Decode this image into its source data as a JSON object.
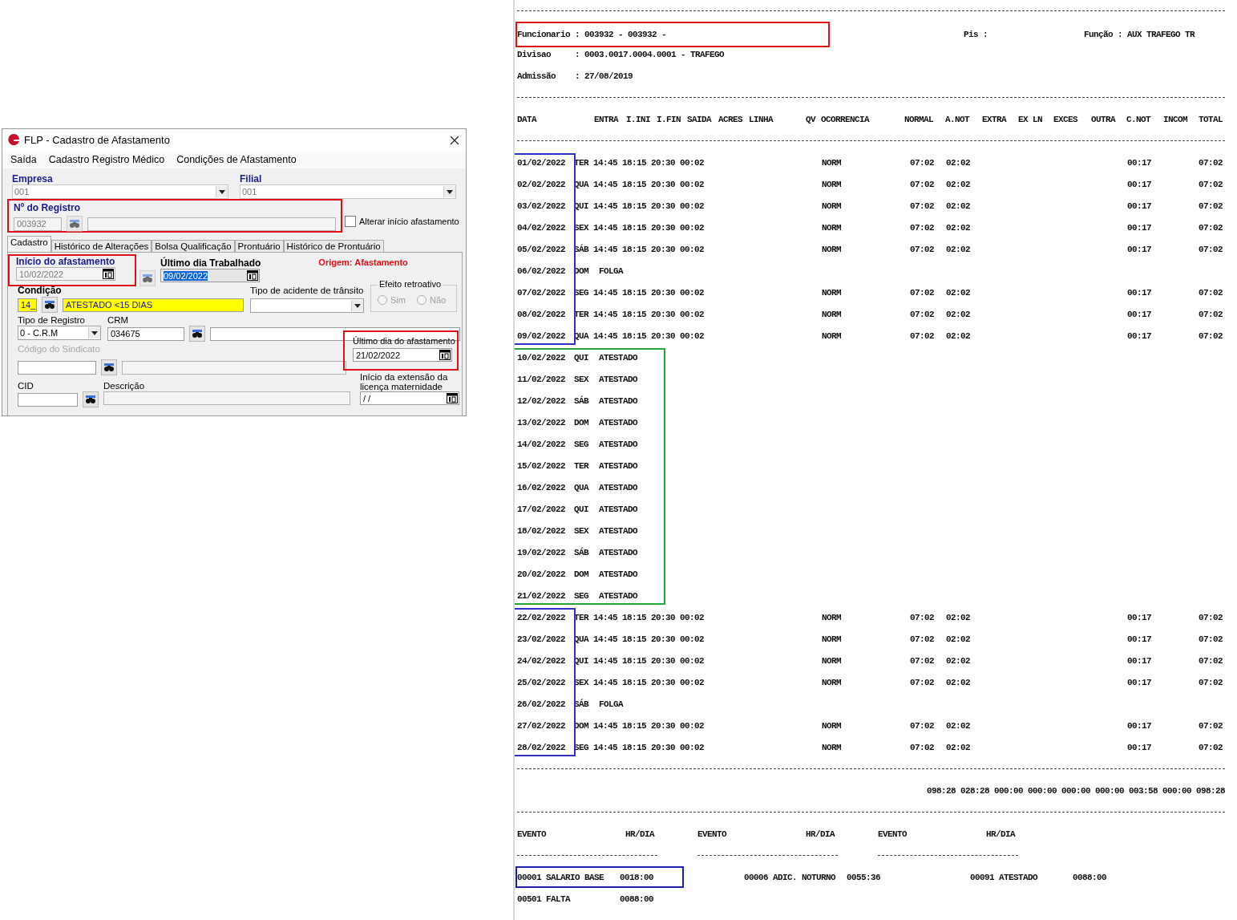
{
  "dialog": {
    "title": "FLP - Cadastro de Afastamento",
    "menu": [
      "Saída",
      "Cadastro Registro Médico",
      "Condições de Afastamento"
    ],
    "empresa": {
      "label": "Empresa",
      "value": "001"
    },
    "filial": {
      "label": "Filial",
      "value": "001"
    },
    "registro": {
      "label": "Nº do Registro",
      "value": "003932",
      "highlighted": true
    },
    "alterar_inicio": {
      "label": "Alterar início afastamento",
      "checked": false
    },
    "tabs": [
      {
        "label": "Cadastro",
        "selected": true
      },
      {
        "label": "Histórico de Alterações",
        "selected": false
      },
      {
        "label": "Bolsa Qualificação",
        "selected": false
      },
      {
        "label": "Prontuário",
        "selected": false
      },
      {
        "label": "Histórico de Prontuário",
        "selected": false
      }
    ],
    "inicio": {
      "label": "Início do afastamento",
      "value": "10/02/2022",
      "highlighted": true
    },
    "ultimo_trabalhado": {
      "label": "Último dia Trabalhado",
      "value": "09/02/2022"
    },
    "origem": "Origem: Afastamento",
    "condicao": {
      "label": "Condição",
      "code": "14_",
      "description": "ATESTADO <15 DIAS"
    },
    "tipo_acidente": {
      "label": "Tipo de acidente de trânsito"
    },
    "efeito_retroativo": {
      "label": "Efeito retroativo",
      "options": [
        {
          "label": "Sim",
          "selected": false
        },
        {
          "label": "Não",
          "selected": false
        }
      ]
    },
    "tipo_registro": {
      "label": "Tipo de Registro",
      "value": "0 - C.R.M"
    },
    "crm": {
      "label": "CRM",
      "value": "034675"
    },
    "codigo_sindicato": {
      "label": "Código do Sindicato",
      "disabled": true
    },
    "ultimo_afastamento": {
      "label": "Último dia do afastamento",
      "value": "21/02/2022",
      "highlighted": true
    },
    "extensao": {
      "label": "Início da extensão da licença maternidade",
      "value": "/ /"
    },
    "cid": {
      "label": "CID"
    },
    "descricao": {
      "label": "Descrição"
    }
  },
  "report": {
    "funcionario": {
      "text": "Funcionario : 003932 - 003932 -",
      "highlighted": true
    },
    "pis": "Pis :",
    "funcao": "Função : AUX TRAFEGO TR",
    "divisao": "Divisao     : 0003.0017.0004.0001 - TRAFEGO",
    "admissao": "Admissão    : 27/08/2019",
    "columns": [
      "DATA",
      "ENTRA",
      "I.INI",
      "I.FIN",
      "SAIDA",
      "ACRES",
      "LINHA",
      "QV",
      "OCORRENCIA",
      "NORMAL",
      "A.NOT",
      "EXTRA",
      "EX LN",
      "EXCES",
      "OUTRA",
      "C.NOT",
      "INCOM",
      "TOTAL"
    ],
    "row_groups": [
      {
        "color": "#3030c8",
        "kind": "dates",
        "rows": [
          {
            "kind": "work",
            "date": "01/02/2022",
            "weekday": "TER",
            "times": "14:45 18:15 20:30 00:02",
            "status": "NORM",
            "normal": "07:02",
            "a_not": "02:02",
            "c_not": "00:17",
            "total": "07:02"
          },
          {
            "kind": "work",
            "date": "02/02/2022",
            "weekday": "QUA",
            "times": "14:45 18:15 20:30 00:02",
            "status": "NORM",
            "normal": "07:02",
            "a_not": "02:02",
            "c_not": "00:17",
            "total": "07:02"
          },
          {
            "kind": "work",
            "date": "03/02/2022",
            "weekday": "QUI",
            "times": "14:45 18:15 20:30 00:02",
            "status": "NORM",
            "normal": "07:02",
            "a_not": "02:02",
            "c_not": "00:17",
            "total": "07:02"
          },
          {
            "kind": "work",
            "date": "04/02/2022",
            "weekday": "SEX",
            "times": "14:45 18:15 20:30 00:02",
            "status": "NORM",
            "normal": "07:02",
            "a_not": "02:02",
            "c_not": "00:17",
            "total": "07:02"
          },
          {
            "kind": "work",
            "date": "05/02/2022",
            "weekday": "SÁB",
            "times": "14:45 18:15 20:30 00:02",
            "status": "NORM",
            "normal": "07:02",
            "a_not": "02:02",
            "c_not": "00:17",
            "total": "07:02"
          },
          {
            "kind": "absent",
            "date": "06/02/2022",
            "weekday": "DOM",
            "status": "FOLGA"
          },
          {
            "kind": "work",
            "date": "07/02/2022",
            "weekday": "SEG",
            "times": "14:45 18:15 20:30 00:02",
            "status": "NORM",
            "normal": "07:02",
            "a_not": "02:02",
            "c_not": "00:17",
            "total": "07:02"
          },
          {
            "kind": "work",
            "date": "08/02/2022",
            "weekday": "TER",
            "times": "14:45 18:15 20:30 00:02",
            "status": "NORM",
            "normal": "07:02",
            "a_not": "02:02",
            "c_not": "00:17",
            "total": "07:02"
          },
          {
            "kind": "work",
            "date": "09/02/2022",
            "weekday": "QUA",
            "times": "14:45 18:15 20:30 00:02",
            "status": "NORM",
            "normal": "07:02",
            "a_not": "02:02",
            "c_not": "00:17",
            "total": "07:02"
          }
        ]
      },
      {
        "color": "#22a83a",
        "kind": "entries",
        "rows": [
          {
            "kind": "absent",
            "date": "10/02/2022",
            "weekday": "QUI",
            "status": "ATESTADO"
          },
          {
            "kind": "absent",
            "date": "11/02/2022",
            "weekday": "SEX",
            "status": "ATESTADO"
          },
          {
            "kind": "absent",
            "date": "12/02/2022",
            "weekday": "SÁB",
            "status": "ATESTADO"
          },
          {
            "kind": "absent",
            "date": "13/02/2022",
            "weekday": "DOM",
            "status": "ATESTADO"
          },
          {
            "kind": "absent",
            "date": "14/02/2022",
            "weekday": "SEG",
            "status": "ATESTADO"
          },
          {
            "kind": "absent",
            "date": "15/02/2022",
            "weekday": "TER",
            "status": "ATESTADO"
          },
          {
            "kind": "absent",
            "date": "16/02/2022",
            "weekday": "QUA",
            "status": "ATESTADO"
          },
          {
            "kind": "absent",
            "date": "17/02/2022",
            "weekday": "QUI",
            "status": "ATESTADO"
          },
          {
            "kind": "absent",
            "date": "18/02/2022",
            "weekday": "SEX",
            "status": "ATESTADO"
          },
          {
            "kind": "absent",
            "date": "19/02/2022",
            "weekday": "SÁB",
            "status": "ATESTADO"
          },
          {
            "kind": "absent",
            "date": "20/02/2022",
            "weekday": "DOM",
            "status": "ATESTADO"
          },
          {
            "kind": "absent",
            "date": "21/02/2022",
            "weekday": "SEG",
            "status": "ATESTADO"
          }
        ]
      },
      {
        "color": "#3030c8",
        "kind": "dates",
        "rows": [
          {
            "kind": "work",
            "date": "22/02/2022",
            "weekday": "TER",
            "times": "14:45 18:15 20:30 00:02",
            "status": "NORM",
            "normal": "07:02",
            "a_not": "02:02",
            "c_not": "00:17",
            "total": "07:02"
          },
          {
            "kind": "work",
            "date": "23/02/2022",
            "weekday": "QUA",
            "times": "14:45 18:15 20:30 00:02",
            "status": "NORM",
            "normal": "07:02",
            "a_not": "02:02",
            "c_not": "00:17",
            "total": "07:02"
          },
          {
            "kind": "work",
            "date": "24/02/2022",
            "weekday": "QUI",
            "times": "14:45 18:15 20:30 00:02",
            "status": "NORM",
            "normal": "07:02",
            "a_not": "02:02",
            "c_not": "00:17",
            "total": "07:02"
          },
          {
            "kind": "work",
            "date": "25/02/2022",
            "weekday": "SEX",
            "times": "14:45 18:15 20:30 00:02",
            "status": "NORM",
            "normal": "07:02",
            "a_not": "02:02",
            "c_not": "00:17",
            "total": "07:02"
          },
          {
            "kind": "absent",
            "date": "26/02/2022",
            "weekday": "SÁB",
            "status": "FOLGA"
          },
          {
            "kind": "work",
            "date": "27/02/2022",
            "weekday": "DOM",
            "times": "14:45 18:15 20:30 00:02",
            "status": "NORM",
            "normal": "07:02",
            "a_not": "02:02",
            "c_not": "00:17",
            "total": "07:02"
          },
          {
            "kind": "work",
            "date": "28/02/2022",
            "weekday": "SEG",
            "times": "14:45 18:15 20:30 00:02",
            "status": "NORM",
            "normal": "07:02",
            "a_not": "02:02",
            "c_not": "00:17",
            "total": "07:02"
          }
        ]
      }
    ],
    "totals": "098:28 028:28 000:00 000:00 000:00 000:00 003:58 000:00 098:28",
    "event_columns": [
      {
        "evento": "EVENTO",
        "hours": "HR/DIA"
      },
      {
        "evento": "EVENTO",
        "hours": "HR/DIA"
      },
      {
        "evento": "EVENTO",
        "hours": "HR/DIA"
      }
    ],
    "events": [
      [
        {
          "name": "00001 SALARIO BASE",
          "hours": "0018:00",
          "highlighted": true
        },
        {
          "name": "00006 ADIC. NOTURNO",
          "hours": "0055:36",
          "highlighted": false
        },
        {
          "name": "00091 ATESTADO",
          "hours": "0088:00",
          "highlighted": false
        }
      ],
      [
        {
          "name": "00501 FALTA",
          "hours": "0088:00",
          "highlighted": false
        }
      ]
    ]
  }
}
